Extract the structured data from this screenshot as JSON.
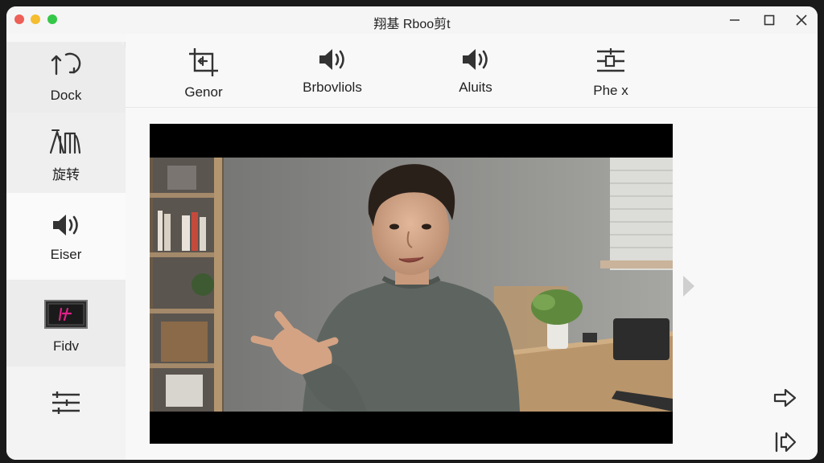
{
  "window": {
    "title": "翔基 Rboo剪t"
  },
  "sidebar": {
    "items": [
      {
        "label": "Dock",
        "icon": "rotate-arrows-icon"
      },
      {
        "label": "旋转",
        "icon": "crop-rotate-icon"
      },
      {
        "label": "Eiser",
        "icon": "speaker-icon"
      },
      {
        "label": "Fidv",
        "icon": "clip-thumbnail-icon"
      },
      {
        "label": "",
        "icon": "sliders-icon"
      }
    ]
  },
  "toolbar": {
    "items": [
      {
        "label": "Genor",
        "icon": "crop-icon"
      },
      {
        "label": "Brbovliols",
        "icon": "speaker-icon"
      },
      {
        "label": "Aluits",
        "icon": "speaker-icon"
      },
      {
        "label": "Phe x",
        "icon": "adjust-sliders-icon"
      }
    ]
  },
  "colors": {
    "accent": "#e0208a",
    "sidebar_bg": "#efefef",
    "preview_bg": "#000000"
  }
}
